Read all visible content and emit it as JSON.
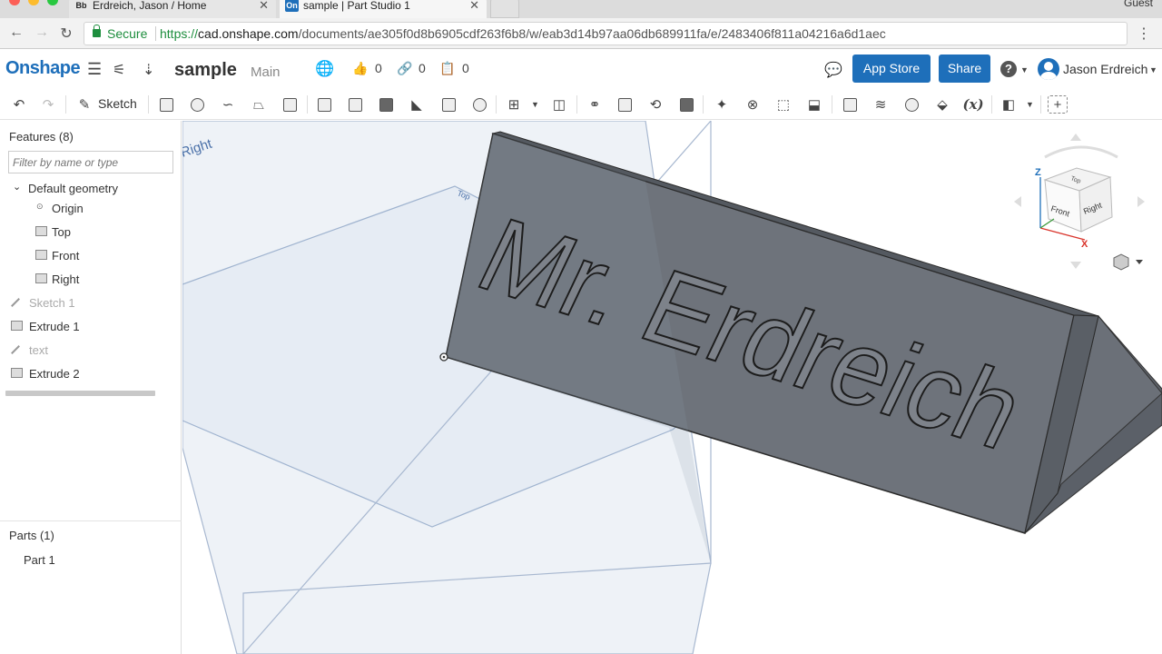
{
  "browser": {
    "tabs": [
      {
        "favicon": "Bb",
        "title": "Erdreich, Jason / Home"
      },
      {
        "favicon": "On",
        "title": "sample | Part Studio 1"
      }
    ],
    "guest_label": "Guest",
    "secure_label": "Secure",
    "url_scheme": "https://",
    "url_host": "cad.onshape.com",
    "url_path": "/documents/ae305f0d8b6905cdf263f6b8/w/eab3d14b97aa06db689911fa/e/2483406f811a04216a6d1aec"
  },
  "header": {
    "logo": "Onshape",
    "document_name": "sample",
    "branch": "Main",
    "likes": "0",
    "links": "0",
    "copies": "0",
    "app_store_label": "App Store",
    "share_label": "Share",
    "help_label": "?",
    "user_name": "Jason Erdreich"
  },
  "toolbar": {
    "sketch_label": "Sketch",
    "variable_label": "(x)"
  },
  "features": {
    "title": "Features (8)",
    "filter_placeholder": "Filter by name or type",
    "default_geometry_label": "Default geometry",
    "items": [
      {
        "label": "Origin"
      },
      {
        "label": "Top"
      },
      {
        "label": "Front"
      },
      {
        "label": "Right"
      },
      {
        "label": "Sketch 1"
      },
      {
        "label": "Extrude 1"
      },
      {
        "label": "text"
      },
      {
        "label": "Extrude 2"
      }
    ]
  },
  "parts": {
    "title": "Parts (1)",
    "items": [
      {
        "label": "Part 1"
      }
    ]
  },
  "viewport": {
    "plane_right_label": "Right",
    "plane_top_label": "Top",
    "engraved_text": "Mr. Erdreich",
    "view_cube": {
      "front": "Front",
      "right": "Right",
      "top": "Top",
      "axis_z": "Z",
      "axis_x": "X"
    }
  }
}
